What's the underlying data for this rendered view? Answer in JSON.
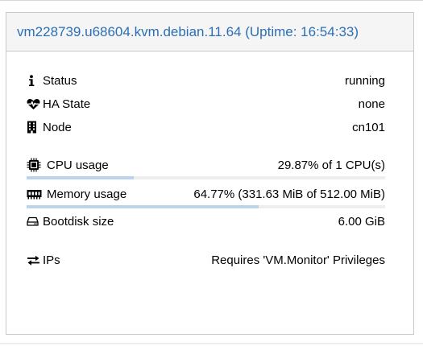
{
  "panel": {
    "title": "vm228739.u68604.kvm.debian.11.64 (Uptime: 16:54:33)"
  },
  "rows": {
    "status": {
      "icon": "info-icon",
      "label": "Status",
      "value": "running"
    },
    "ha_state": {
      "icon": "heartbeat-icon",
      "label": "HA State",
      "value": "none"
    },
    "node": {
      "icon": "building-icon",
      "label": "Node",
      "value": "cn101"
    },
    "cpu": {
      "icon": "cpu-chip-icon",
      "label": "CPU usage",
      "value": "29.87% of 1 CPU(s)",
      "usage_fraction": 0.2987
    },
    "memory": {
      "icon": "memory-icon",
      "label": "Memory usage",
      "value": "64.77% (331.63 MiB of 512.00 MiB)",
      "usage_fraction": 0.6477
    },
    "bootdisk": {
      "icon": "hdd-icon",
      "label": "Bootdisk size",
      "value": "6.00 GiB"
    },
    "ips": {
      "icon": "exchange-arrows-icon",
      "label": "IPs",
      "value": "Requires 'VM.Monitor' Privileges"
    }
  },
  "colors": {
    "title": "#2c6fb5",
    "bar_track": "#eeeeee",
    "bar_fill": "#b9d4ec",
    "header_bg": "#f5f5f5",
    "border": "#c9c9c9"
  }
}
